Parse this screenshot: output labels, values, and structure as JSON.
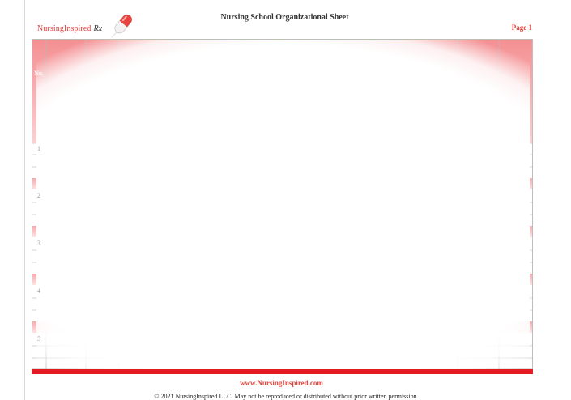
{
  "document": {
    "title": "Nursing School Organizational Sheet",
    "page_label": "Page 1",
    "logo": {
      "name": "NursingInspired",
      "suffix": "Rx",
      "icon": "pill-capsule-icon"
    },
    "table": {
      "header_no": "No.",
      "row_numbers": [
        "1",
        "2",
        "3",
        "4",
        "5"
      ]
    },
    "footer": {
      "website": "www.NursingInspired.com",
      "copyright": "© 2021 NursingInspired LLC. May not be reproduced or distributed without prior written permission."
    },
    "colors": {
      "accent": "#e8433f",
      "bar": "#e31c23",
      "header_fill": "#f27c80",
      "gridline": "#bfbfbf"
    }
  }
}
